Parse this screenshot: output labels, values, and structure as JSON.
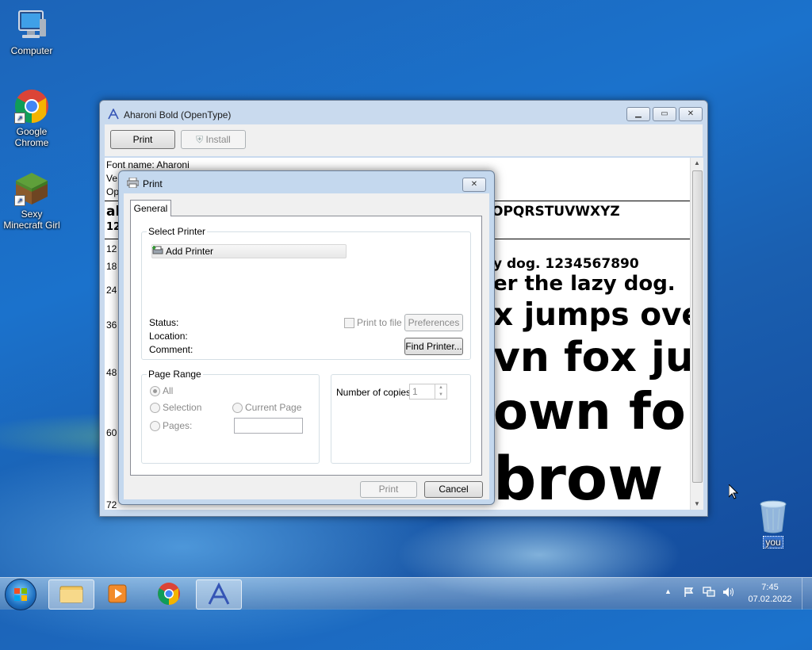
{
  "desktop": {
    "icons": [
      {
        "label": "Computer"
      },
      {
        "label_line1": "Google",
        "label_line2": "Chrome"
      },
      {
        "label_line1": "Sexy",
        "label_line2": "Minecraft Girl"
      },
      {
        "label": "you"
      }
    ]
  },
  "font_viewer": {
    "title": "Aharoni Bold (OpenType)",
    "print_button": "Print",
    "install_button": "Install",
    "font_name_line": "Font name: Aharoni",
    "version_line_partial": "Ve",
    "opentype_line_partial": "Op",
    "alphabet_lower_partial": "al",
    "alphabet_upper_partial": "OPQRSTUVWXYZ",
    "digits_partial": "12",
    "sizes": [
      "12",
      "18",
      "24",
      "36",
      "48",
      "60",
      "72"
    ],
    "samples": [
      "y dog. 1234567890",
      "er the lazy dog.",
      "x jumps ove",
      "vn fox ju",
      "own fo",
      "brow"
    ]
  },
  "print_dialog": {
    "title": "Print",
    "tab_general": "General",
    "select_printer_label": "Select Printer",
    "add_printer": "Add Printer",
    "status_label": "Status:",
    "location_label": "Location:",
    "comment_label": "Comment:",
    "print_to_file": "Print to file",
    "preferences": "Preferences",
    "find_printer": "Find Printer...",
    "page_range_label": "Page Range",
    "all": "All",
    "selection": "Selection",
    "current_page": "Current Page",
    "pages": "Pages:",
    "copies_label": "Number of copies:",
    "copies_value": "1",
    "print_button": "Print",
    "cancel_button": "Cancel"
  },
  "taskbar": {
    "time": "7:45",
    "date": "07.02.2022"
  }
}
